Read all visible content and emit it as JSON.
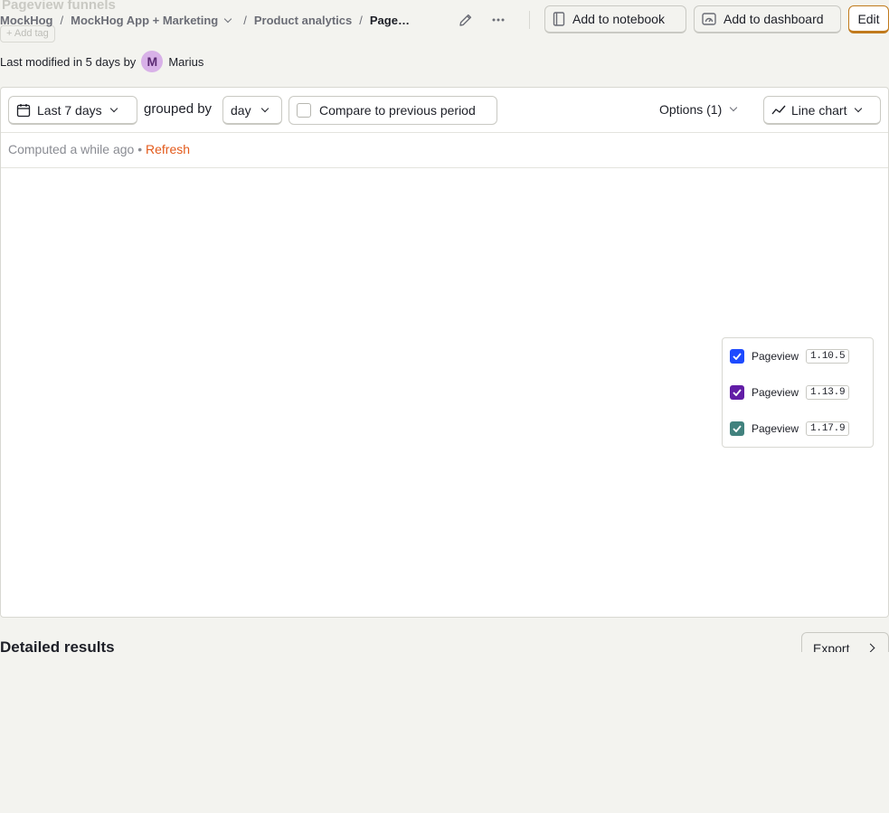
{
  "header": {
    "ghost_title": "Pageview funnels",
    "ghost_tag": "Add tag",
    "breadcrumbs": [
      "MockHog",
      "MockHog App + Marketing",
      "Product analytics",
      "Page…"
    ],
    "separator": "/",
    "add_to_notebook": "Add to notebook",
    "add_to_dashboard": "Add to dashboard",
    "edit": "Edit"
  },
  "meta": {
    "modified_prefix": "Last modified in 5 days by",
    "avatar_initial": "M",
    "author": "Marius"
  },
  "filters": {
    "date_range": "Last 7 days",
    "grouped_by_label": "grouped by",
    "interval": "day",
    "compare_label": "Compare to previous period",
    "compare_checked": false,
    "options": "Options (1)",
    "chart_type": "Line chart"
  },
  "status": {
    "computed": "Computed a while ago",
    "bullet": "•",
    "refresh": "Refresh"
  },
  "legend": [
    {
      "label": "Pageview",
      "version": "1.10.5",
      "color": "#1d4aff",
      "checked": true
    },
    {
      "label": "Pageview",
      "version": "1.13.9",
      "color": "#621da6",
      "checked": true
    },
    {
      "label": "Pageview",
      "version": "1.17.9",
      "color": "#42827e",
      "checked": true
    }
  ],
  "results": {
    "title": "Detailed results",
    "export": "Export"
  }
}
